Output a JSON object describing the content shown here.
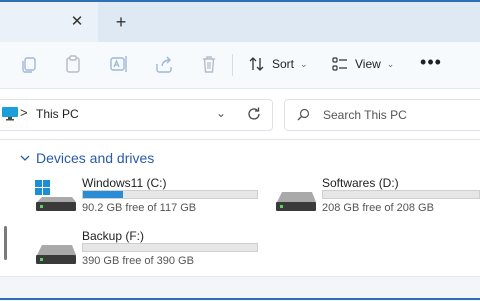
{
  "tabbar": {
    "close_label": "✕",
    "add_label": "+"
  },
  "toolbar": {
    "icons": [
      "copy-icon",
      "paste-icon",
      "rename-icon",
      "share-icon",
      "delete-icon"
    ],
    "sort_label": "Sort",
    "view_label": "View",
    "more_label": "•••"
  },
  "address": {
    "path_label": "This PC",
    "separator": ">",
    "dropdown_glyph": "⌄"
  },
  "search": {
    "placeholder": "Search This PC"
  },
  "section": {
    "title": "Devices and drives"
  },
  "drives": [
    {
      "name": "Windows11 (C:)",
      "free_text": "90.2 GB free of 117 GB",
      "used_fraction": 0.23,
      "system": true
    },
    {
      "name": "Softwares (D:)",
      "free_text": "208 GB free of 208 GB",
      "used_fraction": 0.0,
      "system": false
    },
    {
      "name": "Backup (F:)",
      "free_text": "390 GB free of 390 GB",
      "used_fraction": 0.0,
      "system": false
    }
  ],
  "colors": {
    "accent": "#2a8cd6",
    "section_title": "#2a5aa8"
  }
}
